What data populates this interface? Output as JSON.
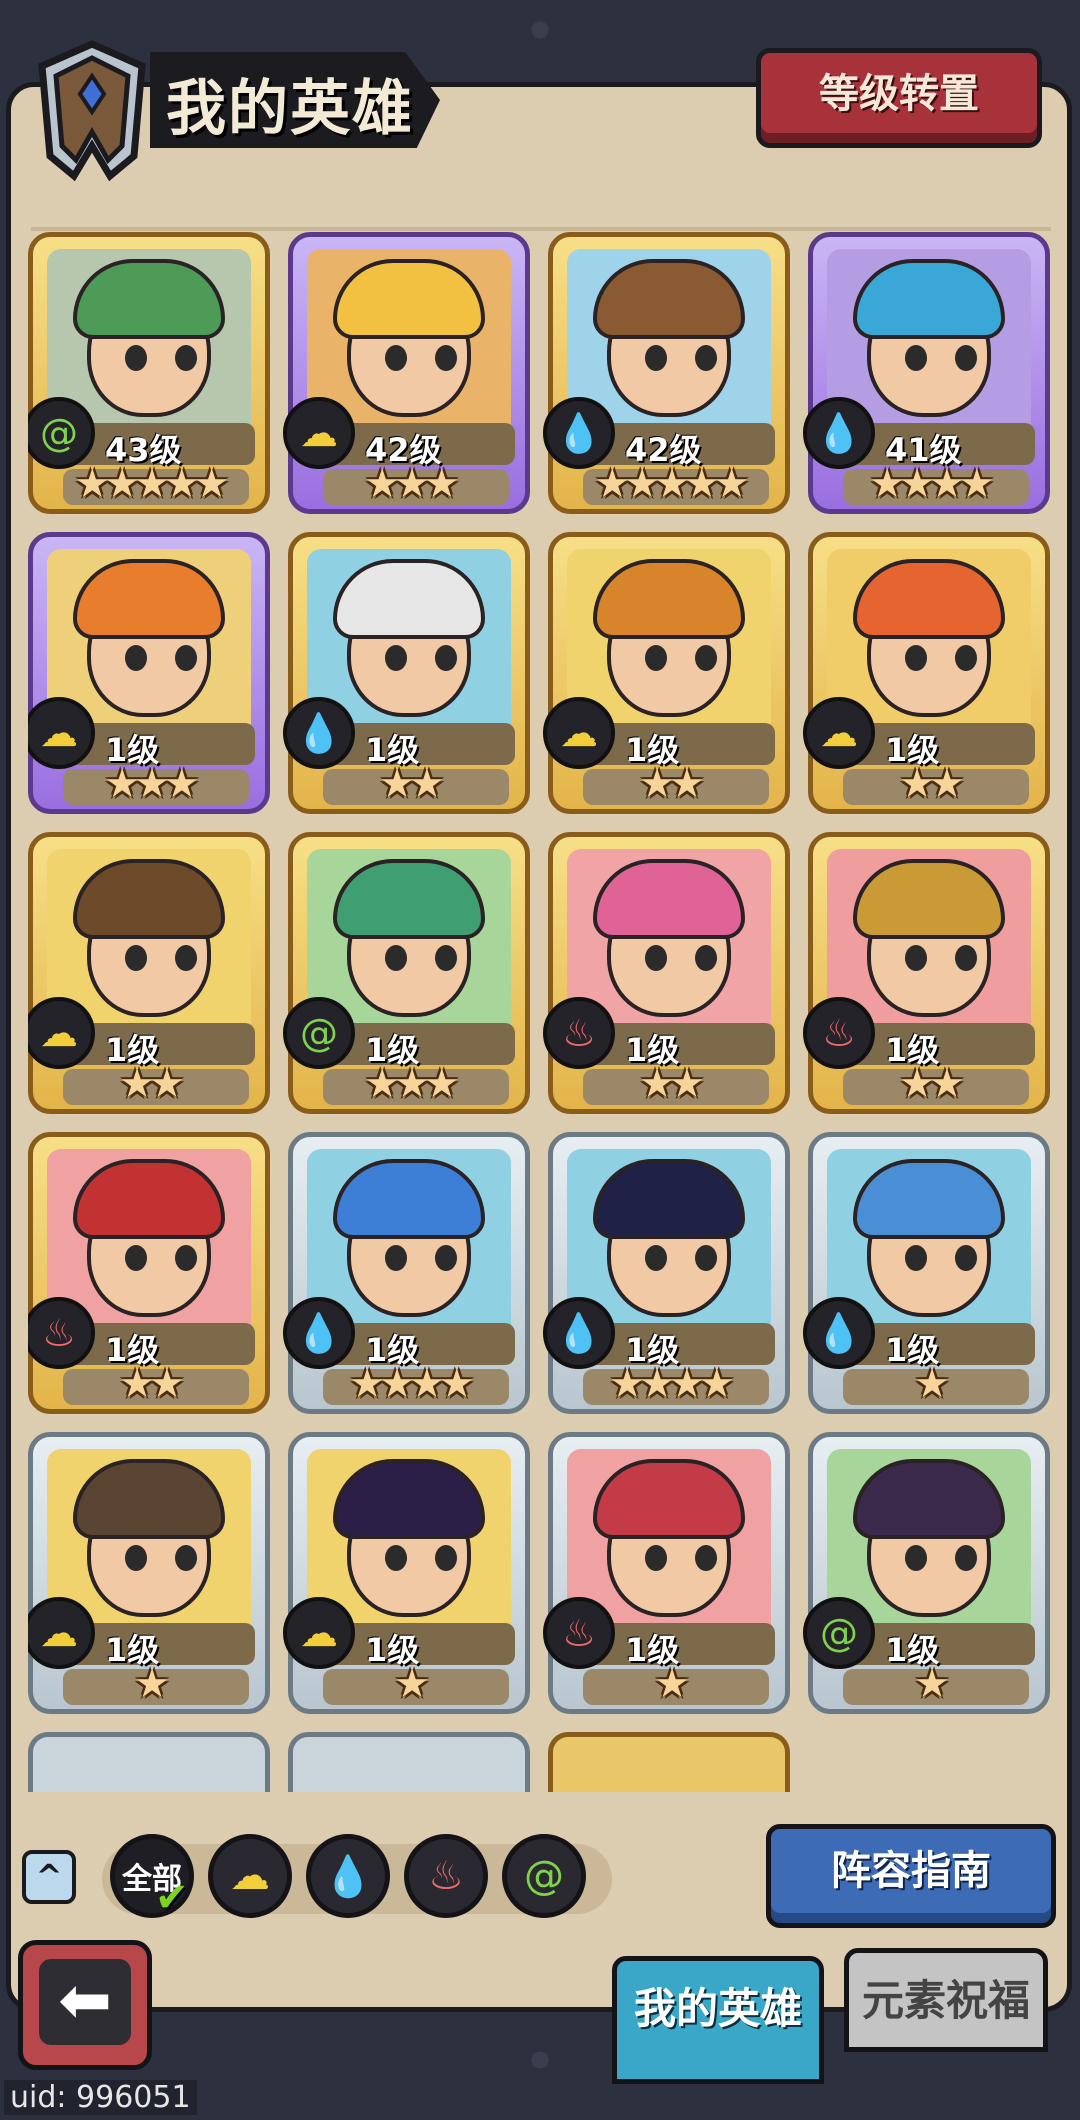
{
  "header": {
    "title": "我的英雄",
    "level_reset_label": "等级转置"
  },
  "heroes": [
    {
      "level": "43级",
      "stars": 5,
      "element": "wind",
      "frame": "gold",
      "hair": "#4e9a57",
      "bg": "#b6c7ad"
    },
    {
      "level": "42级",
      "stars": 3,
      "element": "earth",
      "frame": "purple",
      "hair": "#f2c142",
      "bg": "#e9b36a"
    },
    {
      "level": "42级",
      "stars": 5,
      "element": "water",
      "frame": "gold",
      "hair": "#8a5a33",
      "bg": "#9fd3ea"
    },
    {
      "level": "41级",
      "stars": 4,
      "element": "water",
      "frame": "purple",
      "hair": "#3aa8d6",
      "bg": "#b49de3"
    },
    {
      "level": "1级",
      "stars": 3,
      "element": "earth",
      "frame": "purple",
      "hair": "#e87d2d",
      "bg": "#efd07a"
    },
    {
      "level": "1级",
      "stars": 2,
      "element": "water",
      "frame": "gold",
      "hair": "#e6e6e6",
      "bg": "#8fd0e3"
    },
    {
      "level": "1级",
      "stars": 2,
      "element": "earth",
      "frame": "gold",
      "hair": "#d7842b",
      "bg": "#f1d36e"
    },
    {
      "level": "1级",
      "stars": 2,
      "element": "earth",
      "frame": "gold",
      "hair": "#e6642f",
      "bg": "#f1cd6a"
    },
    {
      "level": "1级",
      "stars": 2,
      "element": "earth",
      "frame": "gold",
      "hair": "#6d4a2a",
      "bg": "#f1d36e"
    },
    {
      "level": "1级",
      "stars": 3,
      "element": "wind",
      "frame": "gold",
      "hair": "#3f9e72",
      "bg": "#a8d59a"
    },
    {
      "level": "1级",
      "stars": 2,
      "element": "fire",
      "frame": "gold",
      "hair": "#e06396",
      "bg": "#f0a4a6"
    },
    {
      "level": "1级",
      "stars": 2,
      "element": "fire",
      "frame": "gold",
      "hair": "#c99a35",
      "bg": "#f09d9d"
    },
    {
      "level": "1级",
      "stars": 2,
      "element": "fire",
      "frame": "gold",
      "hair": "#c33232",
      "bg": "#f0a1a1"
    },
    {
      "level": "1级",
      "stars": 4,
      "element": "water",
      "frame": "silver",
      "hair": "#3d7fd6",
      "bg": "#8fd0e3"
    },
    {
      "level": "1级",
      "stars": 4,
      "element": "water",
      "frame": "silver",
      "hair": "#1f2147",
      "bg": "#8fd0e3"
    },
    {
      "level": "1级",
      "stars": 1,
      "element": "water",
      "frame": "silver",
      "hair": "#4a8fd6",
      "bg": "#8fd0e3"
    },
    {
      "level": "1级",
      "stars": 1,
      "element": "earth",
      "frame": "silver",
      "hair": "#5a4532",
      "bg": "#f1d36e"
    },
    {
      "level": "1级",
      "stars": 1,
      "element": "earth",
      "frame": "silver",
      "hair": "#2b1f47",
      "bg": "#f1d36e"
    },
    {
      "level": "1级",
      "stars": 1,
      "element": "fire",
      "frame": "silver",
      "hair": "#c43b48",
      "bg": "#f0a1a1"
    },
    {
      "level": "1级",
      "stars": 1,
      "element": "wind",
      "frame": "silver",
      "hair": "#3c2a4d",
      "bg": "#a8d59a"
    }
  ],
  "partial_cards": [
    "silver",
    "silver",
    "gold"
  ],
  "filters": {
    "all_label": "全部",
    "items": [
      "earth",
      "water",
      "fire",
      "wind"
    ]
  },
  "buttons": {
    "guide_label": "阵容指南",
    "back_icon": "back-arrow-icon"
  },
  "tabs": {
    "my_heroes": "我的英雄",
    "element_blessing": "元素祝福"
  },
  "uid": "uid: 996051",
  "element_colors": {
    "earth": "#f2cf3a",
    "water": "#4fb3ef",
    "fire": "#f06a6a",
    "wind": "#7ed34a"
  }
}
